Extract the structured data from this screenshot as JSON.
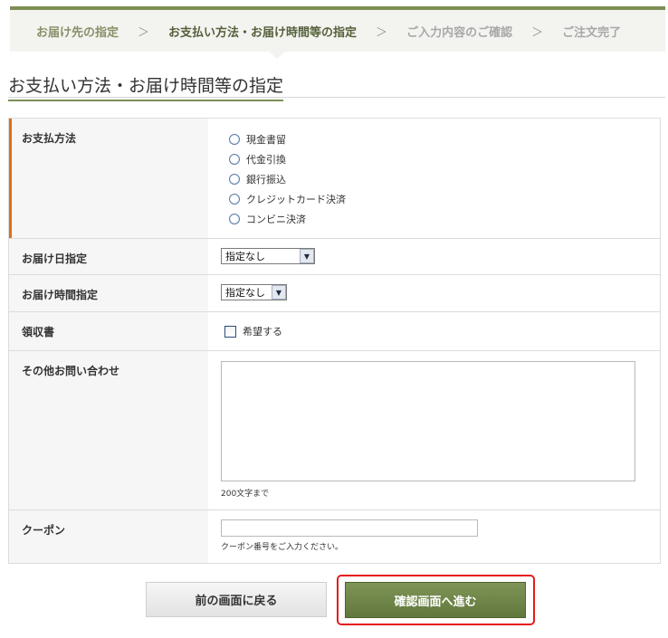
{
  "steps": {
    "step1": "お届け先の指定",
    "step2": "お支払い方法・お届け時間等の指定",
    "step3": "ご入力内容のご確認",
    "step4": "ご注文完了",
    "separator": "＞"
  },
  "page": {
    "title": "お支払い方法・お届け時間等の指定"
  },
  "form": {
    "payment": {
      "label": "お支払方法",
      "options": [
        "現金書留",
        "代金引換",
        "銀行振込",
        "クレジットカード決済",
        "コンビニ決済"
      ]
    },
    "delivery_date": {
      "label": "お届け日指定",
      "selected": "指定なし"
    },
    "delivery_time": {
      "label": "お届け時間指定",
      "selected": "指定なし"
    },
    "receipt": {
      "label": "領収書",
      "option": "希望する"
    },
    "inquiry": {
      "label": "その他お問い合わせ",
      "note": "200文字まで",
      "value": ""
    },
    "coupon": {
      "label": "クーポン",
      "note": "クーポン番号をご入力ください。",
      "value": ""
    }
  },
  "buttons": {
    "back": "前の画面に戻る",
    "next": "確認画面へ進む"
  },
  "colors": {
    "accent": "#7b8f55",
    "required_marker": "#e36b18",
    "highlight_frame": "#e51b1b"
  }
}
